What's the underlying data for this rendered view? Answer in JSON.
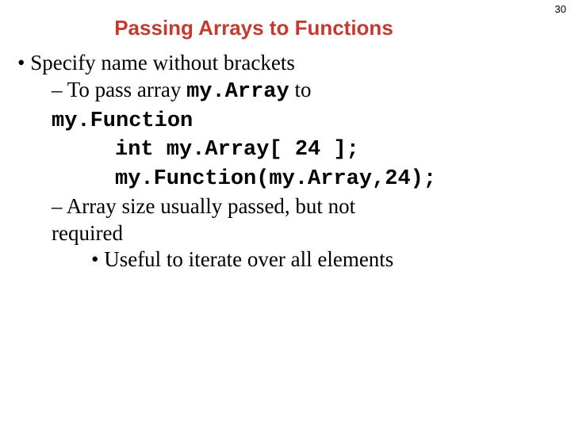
{
  "page_number": "30",
  "title": "Passing Arrays to Functions",
  "lines": {
    "b1": "• Specify name without brackets",
    "d1_a": "– To pass array ",
    "d1_b": "my.Array",
    "d1_c": " to",
    "d1_cont": "my.Function",
    "code1": "int my.Array[ 24 ];",
    "code2": "my.Function(my.Array,24);",
    "d2_l1": "– Array size usually passed, but not",
    "d2_l2": "required",
    "b2": "• Useful to iterate over all elements"
  }
}
